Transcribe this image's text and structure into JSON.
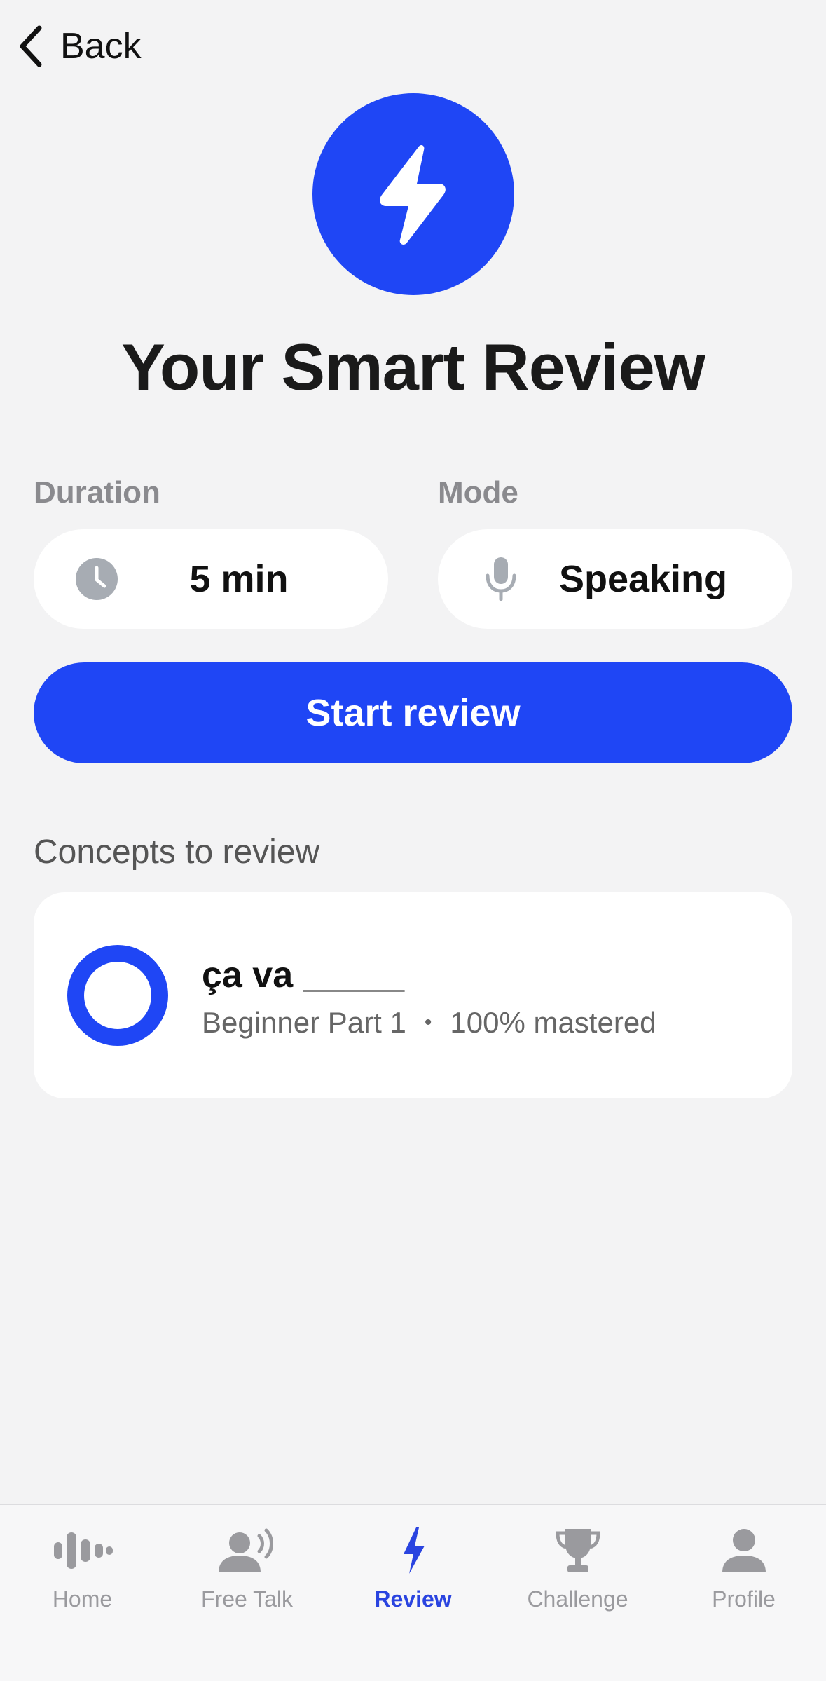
{
  "nav": {
    "back_label": "Back"
  },
  "title": "Your Smart Review",
  "duration": {
    "label": "Duration",
    "value": "5 min",
    "icon": "clock-icon"
  },
  "mode": {
    "label": "Mode",
    "value": "Speaking",
    "icon": "microphone-icon"
  },
  "start_button": {
    "label": "Start review"
  },
  "concepts": {
    "heading": "Concepts to review",
    "items": [
      {
        "title": "ça va _____",
        "level": "Beginner Part 1",
        "separator": "•",
        "mastery": "100% mastered",
        "mastery_fraction": 1.0
      }
    ]
  },
  "tabs": [
    {
      "label": "Home",
      "icon": "waveform-icon",
      "active": false
    },
    {
      "label": "Free Talk",
      "icon": "person-speaking-icon",
      "active": false
    },
    {
      "label": "Review",
      "icon": "lightning-bolt-icon",
      "active": true
    },
    {
      "label": "Challenge",
      "icon": "trophy-icon",
      "active": false
    },
    {
      "label": "Profile",
      "icon": "person-icon",
      "active": false
    }
  ],
  "colors": {
    "accent": "#1f46f5",
    "background": "#f3f3f4",
    "icon_gray": "#a7acb3",
    "tab_inactive": "#9a9a9e",
    "tab_active": "#2a44e0"
  }
}
